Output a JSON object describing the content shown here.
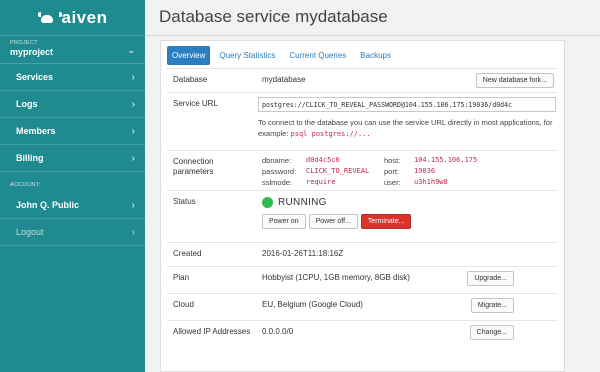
{
  "brand": {
    "name": "aiven"
  },
  "sidebar": {
    "project_label": "PROJECT",
    "project_name": "myproject",
    "items": [
      {
        "label": "Services"
      },
      {
        "label": "Logs"
      },
      {
        "label": "Members"
      },
      {
        "label": "Billing"
      }
    ],
    "account_label": "ACCOUNT:",
    "account_name": "John Q. Public",
    "logout_label": "Logout"
  },
  "header": {
    "title": "Database service mydatabase"
  },
  "tabs": [
    {
      "label": "Overview",
      "active": true
    },
    {
      "label": "Query Statistics",
      "active": false
    },
    {
      "label": "Current Queries",
      "active": false
    },
    {
      "label": "Backups",
      "active": false
    }
  ],
  "details": {
    "database": {
      "label": "Database",
      "value": "mydatabase",
      "button": "New database fork..."
    },
    "service_url": {
      "label": "Service URL",
      "value": "postgres://CLICK_TO_REVEAL_PASSWORD@104.155.106.175:19036/d0d4c",
      "hint": "To connect to the database you can use the service URL directly in most applications, for example:",
      "example": "psql postgres://..."
    },
    "connection": {
      "label_line1": "Connection",
      "label_line2": "parameters",
      "dbname_key": "dbname:",
      "dbname_val": "d0d4c5c6",
      "password_key": "password:",
      "password_val": "CLICK_TO_REVEAL",
      "sslmode_key": "sslmode:",
      "sslmode_val": "require",
      "host_key": "host:",
      "host_val": "104.155.106.175",
      "port_key": "port:",
      "port_val": "19036",
      "user_key": "user:",
      "user_val": "u3h1h9w8"
    },
    "status": {
      "label": "Status",
      "value": "RUNNING",
      "indicator_color": "#2fba4e",
      "power_on": "Power on",
      "power_off": "Power off...",
      "terminate": "Terminate..."
    },
    "created": {
      "label": "Created",
      "value": "2016-01-26T11:18:16Z"
    },
    "plan": {
      "label": "Plan",
      "value": "Hobbyist (1CPU, 1GB memory, 8GB disk)",
      "button": "Upgrade..."
    },
    "cloud": {
      "label": "Cloud",
      "value": "EU, Belgium (Google Cloud)",
      "button": "Migrate..."
    },
    "ip": {
      "label": "Allowed IP Addresses",
      "value": "0.0.0.0/0",
      "button": "Change..."
    }
  },
  "colors": {
    "sidebar": "#1f8a8f",
    "accent": "#2b7fc1",
    "danger": "#d9342b"
  }
}
